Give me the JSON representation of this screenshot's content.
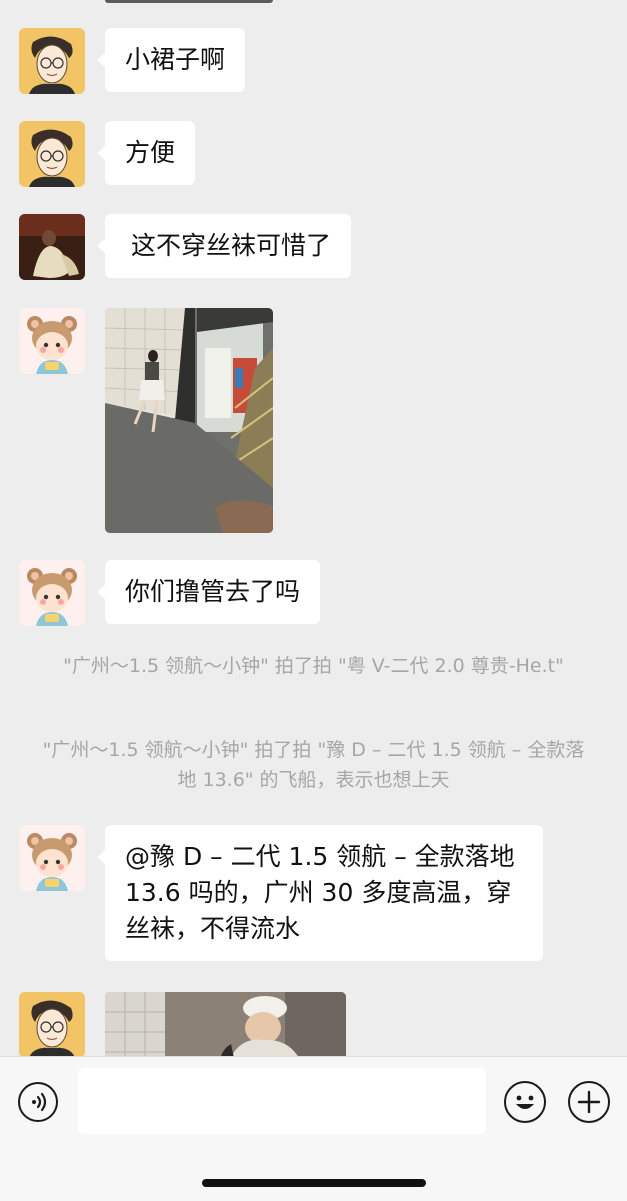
{
  "messages": [
    {
      "sender": "guy-sketch",
      "text": "小裙子啊"
    },
    {
      "sender": "guy-sketch",
      "text": "方便"
    },
    {
      "sender": "dark-photo-user",
      "text": "这不穿丝袜可惜了"
    },
    {
      "sender": "bear-girl",
      "type": "image",
      "image_desc": "corridor-photo"
    },
    {
      "sender": "bear-girl",
      "text": "你们撸管去了吗"
    },
    {
      "sender": "guy-sketch",
      "type": "image",
      "image_desc": "cook-photo"
    }
  ],
  "system_notices": [
    "\"广州～1.5 领航～小钟\" 拍了拍 \"粤 V-二代 2.0 尊贵-He.t\"",
    "\"广州～1.5 领航～小钟\" 拍了拍 \"豫 D – 二代 1.5 领航 – 全款落地 13.6\" 的飞船，表示也想上天"
  ],
  "long_message": {
    "sender": "bear-girl",
    "text": "@豫 D – 二代 1.5 领航 – 全款落地 13.6 吗的，广州 30 多度高温，穿丝袜，不得流水"
  },
  "input_bar": {
    "left_icon": "voice-icon",
    "input_value": "",
    "emoji_icon": "emoji-icon",
    "plus_icon": "plus-icon"
  },
  "colors": {
    "background": "#ededed",
    "bubble": "#ffffff",
    "system_text": "#a6a6a6",
    "bar": "#f7f7f7"
  }
}
